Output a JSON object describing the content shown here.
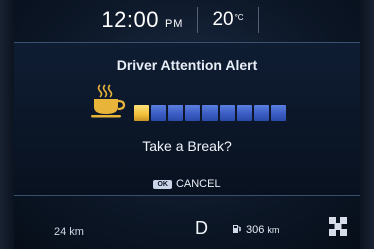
{
  "status_bar": {
    "time": "12:00",
    "ampm": "PM",
    "temperature": "20",
    "temperature_unit": "°C"
  },
  "alert": {
    "title": "Driver Attention Alert",
    "meter": {
      "total_segments": 9,
      "attention_level_fraction": 0.11
    },
    "prompt": "Take a Break?",
    "ok_badge": "OK",
    "cancel_label": "CANCEL"
  },
  "bottom_bar": {
    "trip_distance": "24 km",
    "gear": "D",
    "range_value": "306",
    "range_unit": "km"
  },
  "icons": {
    "coffee": "coffee-cup-icon",
    "fuel": "fuel-pump-icon",
    "pedestrian": "pedestrian-icon"
  },
  "colors": {
    "background": "#0b1626",
    "meter_blue": "#3b5dc4",
    "meter_yellow": "#f2bf3a",
    "cup_gold": "#e8b53a"
  }
}
